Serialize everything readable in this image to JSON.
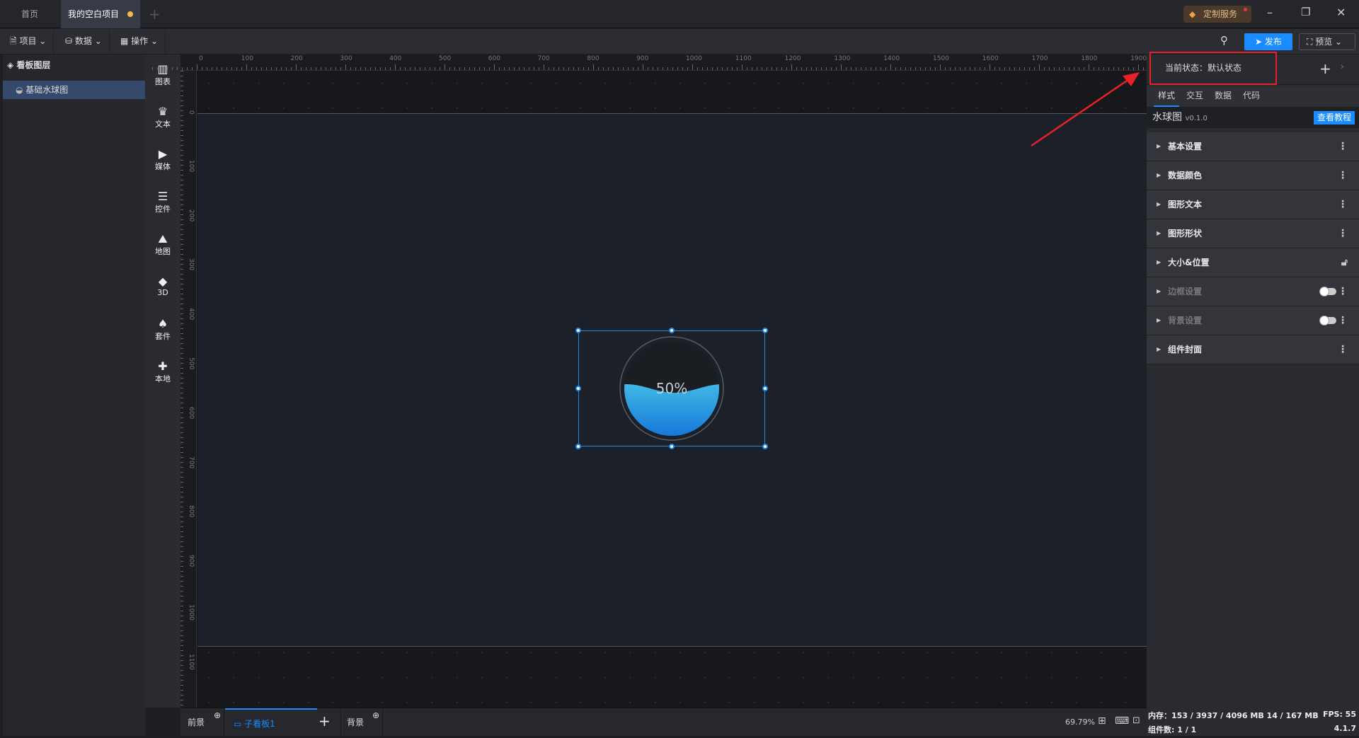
{
  "tabs": [
    {
      "label": "首页"
    },
    {
      "label": "我的空白项目"
    }
  ],
  "titlebar": {
    "service": "定制服务"
  },
  "toolbar": {
    "project": "项目",
    "data": "数据",
    "operate": "操作",
    "publish": "发布",
    "preview": "预览"
  },
  "layers": {
    "title": "看板图层",
    "items": [
      {
        "label": "基础水球图"
      }
    ]
  },
  "component_bar": [
    {
      "label": "图表",
      "icon": "chart-icon"
    },
    {
      "label": "文本",
      "icon": "text-icon"
    },
    {
      "label": "媒体",
      "icon": "media-icon"
    },
    {
      "label": "控件",
      "icon": "control-icon"
    },
    {
      "label": "地图",
      "icon": "map-icon"
    },
    {
      "label": "3D",
      "icon": "cube-icon"
    },
    {
      "label": "套件",
      "icon": "kit-icon"
    },
    {
      "label": "本地",
      "icon": "puzzle-icon"
    }
  ],
  "ruler": {
    "top": [
      "0",
      "100",
      "200",
      "300",
      "400",
      "500",
      "600",
      "700",
      "800",
      "900",
      "1000",
      "1100",
      "1200",
      "1300",
      "1400",
      "1500",
      "1600",
      "1700",
      "1800",
      "1900"
    ],
    "left": [
      "0",
      "100",
      "200",
      "300",
      "400",
      "500",
      "600",
      "700",
      "800",
      "900",
      "1000",
      "1100"
    ]
  },
  "widget": {
    "value_text": "50%",
    "fill": 0.5
  },
  "right_panel": {
    "state_label": "当前状态：默认状态",
    "tabs": [
      "样式",
      "交互",
      "数据",
      "代码"
    ],
    "component_name": "水球图",
    "version": "v0.1.0",
    "tutorial": "查看教程",
    "sections": [
      {
        "label": "基本设置"
      },
      {
        "label": "数据颜色"
      },
      {
        "label": "图形文本"
      },
      {
        "label": "图形形状"
      },
      {
        "label": "大小&位置"
      },
      {
        "label": "边框设置"
      },
      {
        "label": "背景设置"
      },
      {
        "label": "组件封面"
      }
    ]
  },
  "bottom": {
    "foreground": "前景",
    "subboard": "子看板1",
    "background": "背景",
    "zoom": "69.79%"
  },
  "status": {
    "memory": "内存：153 / 3937 / 4096 MB  14 / 167 MB",
    "fps": "FPS:  55",
    "components": "组件数: 1 / 1",
    "version": "4.1.7"
  },
  "colors": {
    "accent": "#1e88e5",
    "highlight": "#e8202a"
  }
}
